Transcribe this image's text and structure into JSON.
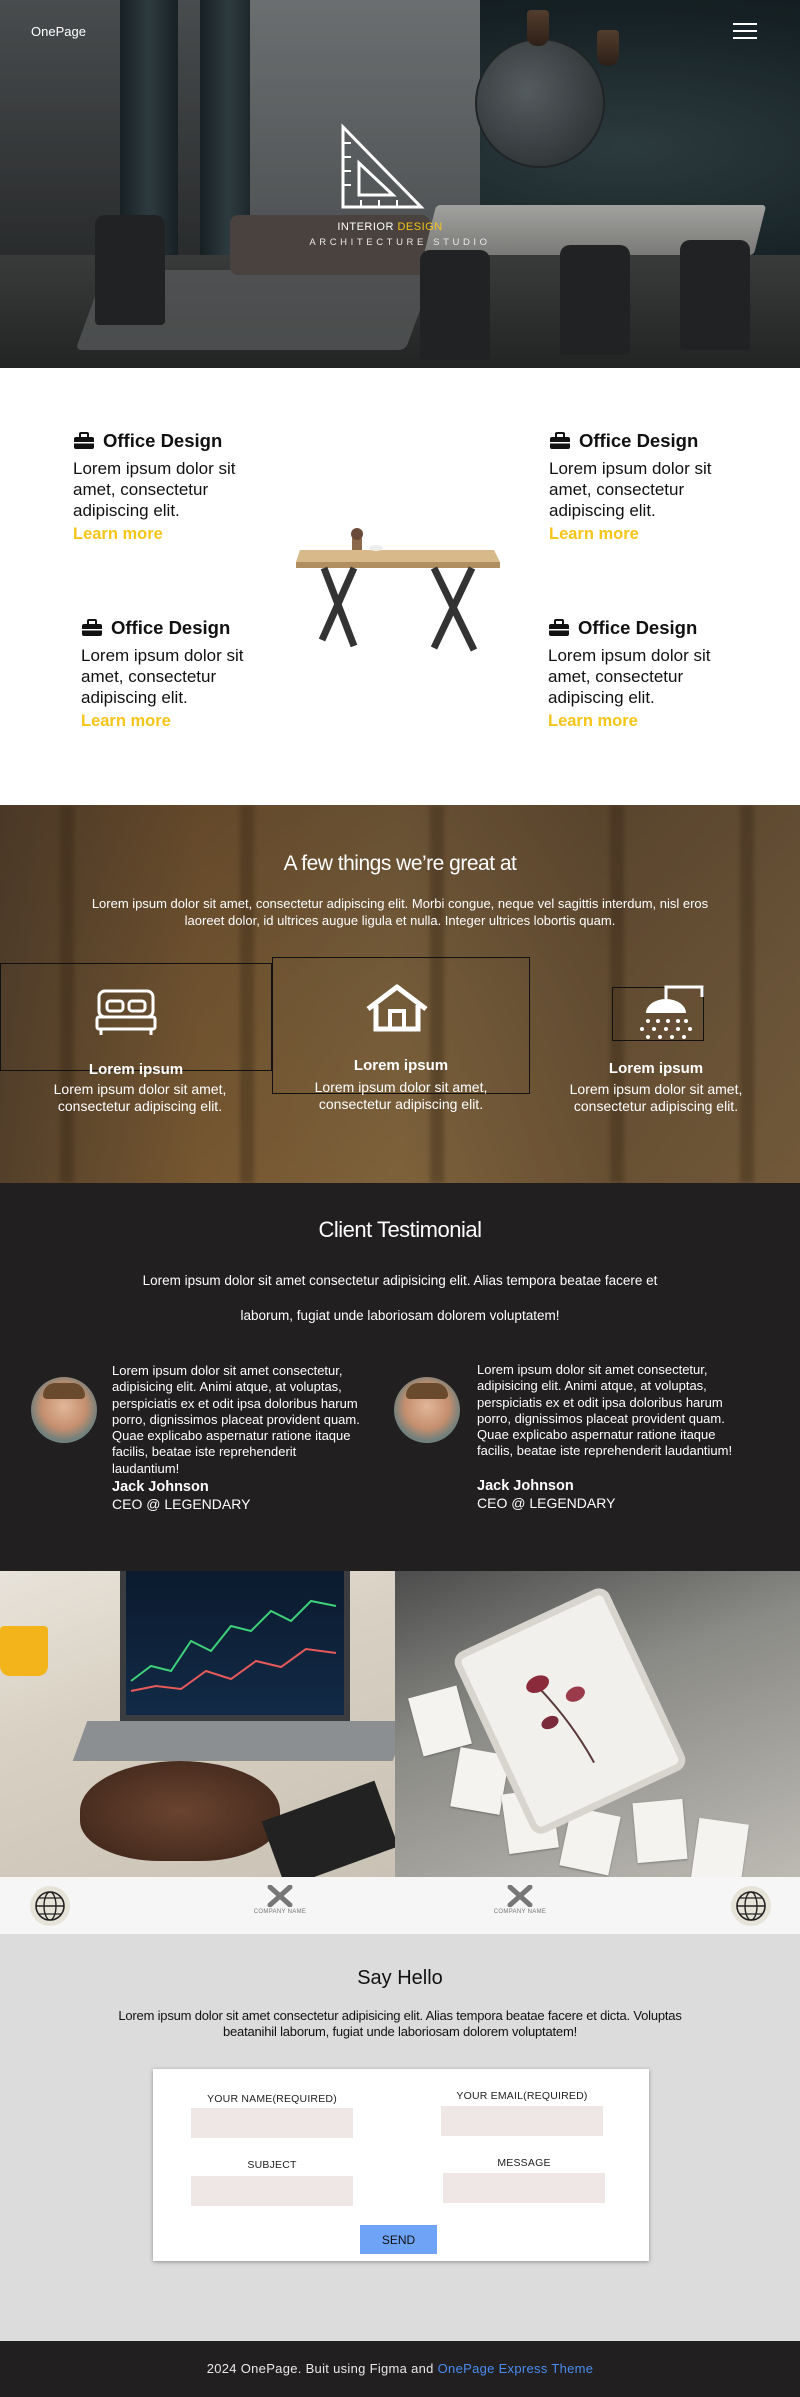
{
  "header": {
    "brand": "OnePage",
    "logo_line1_a": "INTERIOR",
    "logo_line1_b": "DESIGN",
    "logo_line2": "ARCHITECTURE STUDIO"
  },
  "services": [
    {
      "title": "Office Design",
      "body": "Lorem ipsum dolor sit amet, consectetur adipiscing elit.",
      "link": "Learn more"
    },
    {
      "title": "Office Design",
      "body": "Lorem ipsum dolor sit amet, consectetur adipiscing elit.",
      "link": "Learn more"
    },
    {
      "title": "Office Design",
      "body": "Lorem ipsum dolor sit amet, consectetur adipiscing elit.",
      "link": "Learn more"
    },
    {
      "title": "Office Design",
      "body": "Lorem ipsum dolor sit amet, consectetur adipiscing elit.",
      "link": "Learn more"
    }
  ],
  "great_at": {
    "title": "A few things we’re great at",
    "subtitle": "Lorem ipsum dolor sit amet, consectetur adipiscing elit. Morbi congue, neque vel sagittis interdum, nisl eros laoreet dolor, id ultrices augue ligula et nulla. Integer ultrices lobortis quam.",
    "items": [
      {
        "icon": "bed-icon",
        "name": "Lorem ipsum",
        "text": "Lorem ipsum dolor sit amet, consectetur adipiscing elit."
      },
      {
        "icon": "home-icon",
        "name": "Lorem ipsum",
        "text": "Lorem ipsum dolor sit amet, consectetur adipiscing elit."
      },
      {
        "icon": "shower-icon",
        "name": "Lorem ipsum",
        "text": "Lorem ipsum dolor sit amet, consectetur adipiscing elit."
      }
    ]
  },
  "testimonial": {
    "title": "Client Testimonial",
    "subtitle": "Lorem ipsum dolor sit amet consectetur adipisicing elit. Alias tempora beatae facere et laborum, fugiat unde laboriosam dolorem voluptatem!",
    "items": [
      {
        "quote": "Lorem ipsum dolor sit amet consectetur, adipisicing elit. Animi atque, at voluptas, perspiciatis ex et odit ipsa doloribus harum porro, dignissimos placeat provident quam. Quae explicabo aspernatur ratione itaque facilis, beatae iste reprehenderit laudantium!",
        "name": "Jack Johnson",
        "role": "CEO @ LEGENDARY"
      },
      {
        "quote": "Lorem ipsum dolor sit amet consectetur, adipisicing elit. Animi atque, at voluptas, perspiciatis ex et odit ipsa doloribus harum porro, dignissimos placeat provident quam. Quae explicabo aspernatur ratione itaque facilis, beatae iste reprehenderit laudantium!",
        "name": "Jack Johnson",
        "role": "CEO @ LEGENDARY"
      }
    ]
  },
  "partners": {
    "company_label": "COMPANY NAME"
  },
  "hello": {
    "title": "Say Hello",
    "subtitle": "Lorem ipsum dolor sit amet consectetur adipisicing elit. Alias tempora beatae facere et dicta. Voluptas beatanihil laborum, fugiat unde laboriosam dolorem voluptatem!",
    "name_label": "YOUR NAME(REQUIRED)",
    "email_label": "YOUR EMAIL(REQUIRED)",
    "subject_label": "SUBJECT",
    "message_label": "MESSAGE",
    "send_label": "SEND"
  },
  "footer": {
    "text": "2024 OnePage. Buit  using Figma and",
    "link": "OnePage Express Theme"
  },
  "colors": {
    "accent": "#f5c518",
    "dark": "#211f20",
    "send": "#6fa3f5",
    "link": "#4a8cf0"
  }
}
